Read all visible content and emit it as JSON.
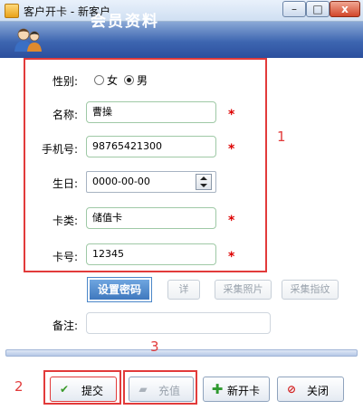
{
  "window": {
    "title": "客户开卡 - 新客户",
    "min": "–",
    "max": "□",
    "close": "x"
  },
  "header": {
    "title": "会员资料"
  },
  "form": {
    "gender_label": "性别:",
    "gender_options": [
      "女",
      "男"
    ],
    "gender_selected": "男",
    "name_label": "名称:",
    "name_value": "曹操",
    "phone_label": "手机号:",
    "phone_value": "98765421300",
    "birthday_label": "生日:",
    "birthday_value": "0000-00-00",
    "card_type_label": "卡类:",
    "card_type_value": "储值卡",
    "card_no_label": "卡号:",
    "card_no_value": "12345",
    "required_mark": "*",
    "remark_label": "备注:",
    "remark_value": ""
  },
  "tools": {
    "set_password": "设置密码",
    "detail": "详",
    "capture_photo": "采集照片",
    "capture_fingerprint": "采集指纹"
  },
  "actions": {
    "submit": "提交",
    "recharge": "充值",
    "new_card": "新开卡",
    "close": "关闭"
  },
  "annotations": [
    "1",
    "2",
    "3"
  ],
  "colors": {
    "header": "#3e66b1",
    "required": "#dd0000",
    "annotation": "#e23b3b",
    "password_button": "#4a86c8"
  }
}
